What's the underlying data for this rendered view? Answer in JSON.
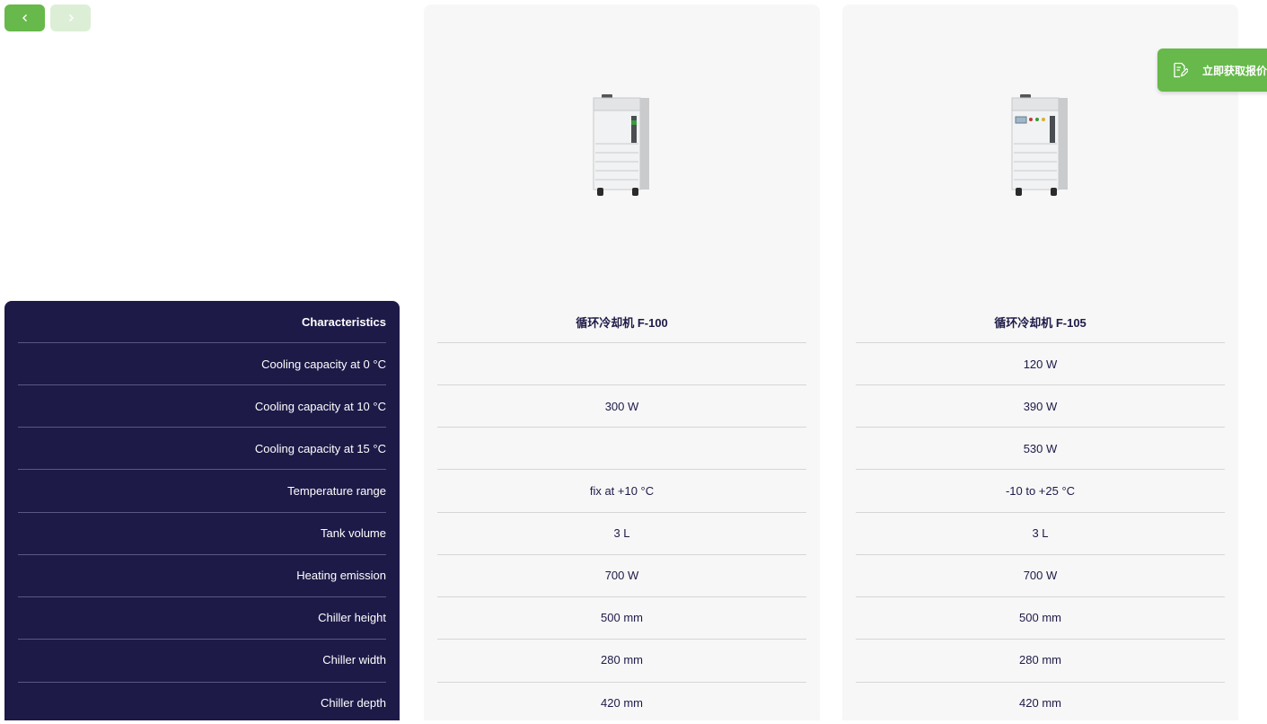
{
  "nav": {
    "prev_icon": "chevron-left-icon",
    "next_icon": "chevron-right-icon"
  },
  "specs": {
    "header": "Characteristics",
    "rows": [
      "Cooling capacity at 0 °C",
      "Cooling capacity at 10 °C",
      "Cooling capacity at 15 °C",
      "Temperature range",
      "Tank volume",
      "Heating emission",
      "Chiller height",
      "Chiller width",
      "Chiller depth"
    ]
  },
  "products": [
    {
      "name": "循环冷却机 F-100",
      "values": [
        "",
        "300 W",
        "",
        "fix at +10 °C",
        "3 L",
        "700 W",
        "500 mm",
        "280 mm",
        "420 mm"
      ]
    },
    {
      "name": "循环冷却机 F-105",
      "values": [
        "120 W",
        "390 W",
        "530 W",
        "-10 to +25 °C",
        "3 L",
        "700 W",
        "500 mm",
        "280 mm",
        "420 mm"
      ]
    }
  ],
  "quote": {
    "label": "立即获取报价",
    "icon": "edit-document-icon"
  },
  "colors": {
    "accent": "#66b94a",
    "accent_light": "#dcefd6",
    "navy": "#1d1a48",
    "card_bg": "#f7f7f7"
  }
}
